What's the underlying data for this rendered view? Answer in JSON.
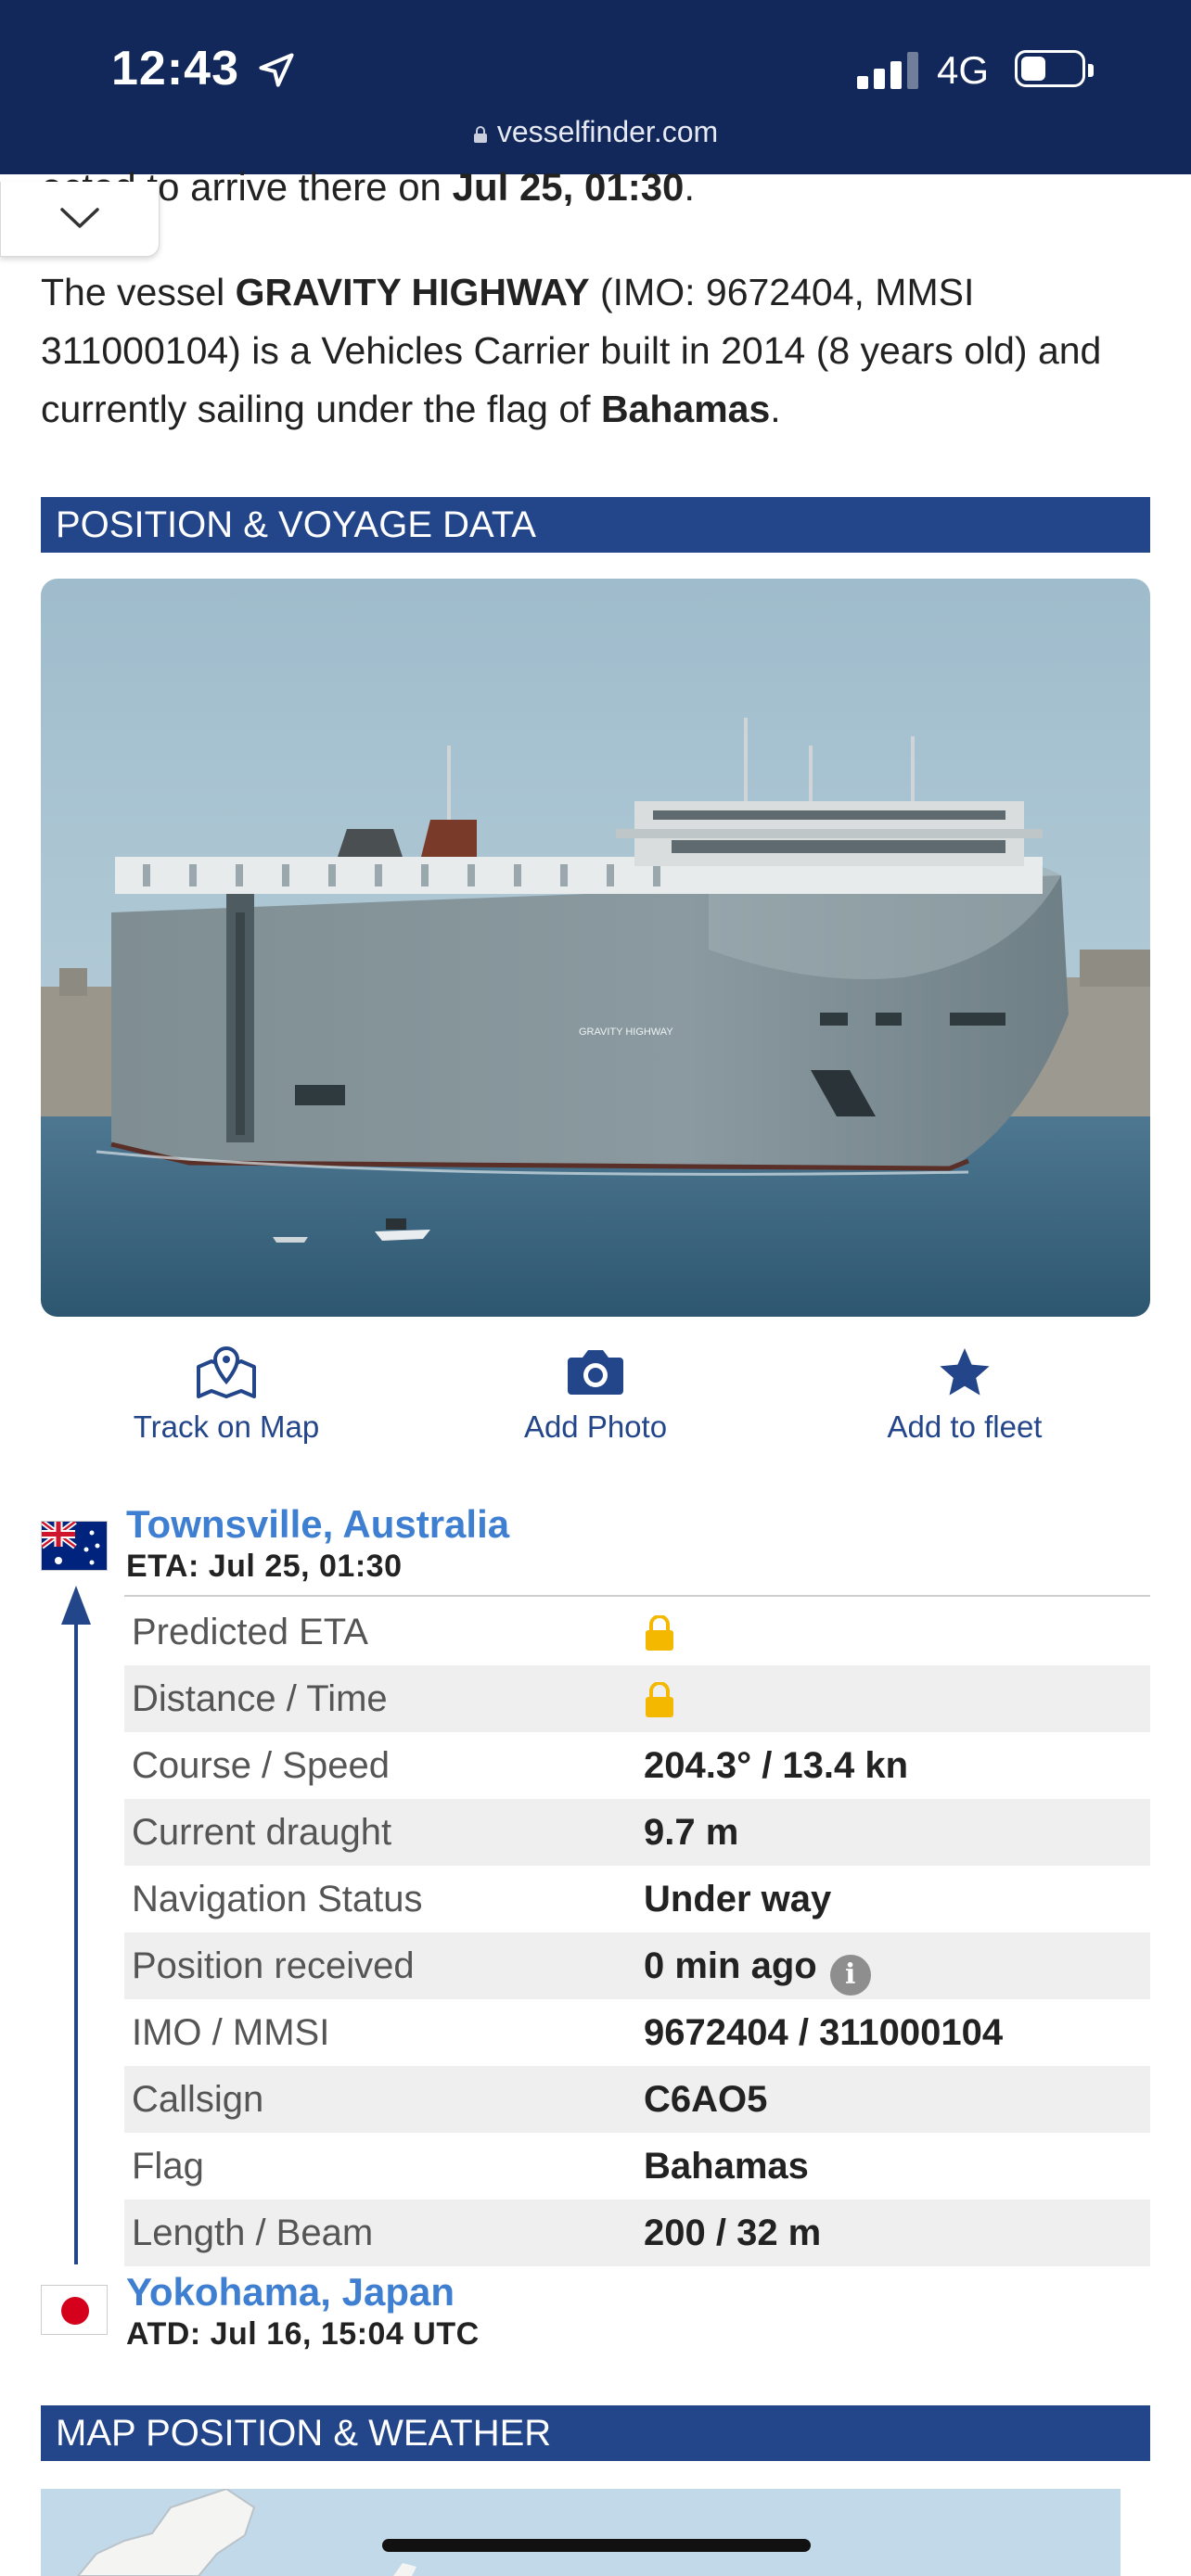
{
  "status": {
    "time": "12:43",
    "network": "4G",
    "battery_fraction": 0.4
  },
  "browser": {
    "url": "vesselfinder.com"
  },
  "intro": {
    "partial_prefix": "ected to arrive there on ",
    "partial_date": "Jul 25, 01:30",
    "partial_suffix": ".",
    "p1": "The vessel ",
    "vessel_name": "GRAVITY HIGHWAY",
    "p2": " (IMO: 9672404, MMSI 311000104) is a Vehicles Carrier built in 2014 (8 years old) and currently sailing under the flag of ",
    "flag_name": "Bahamas",
    "p3": "."
  },
  "sections": {
    "position_voyage": "POSITION & VOYAGE DATA",
    "map_weather": "MAP POSITION & WEATHER"
  },
  "photo": {
    "hull_text": "GRAVITY HIGHWAY"
  },
  "actions": {
    "track": "Track on Map",
    "photo": "Add Photo",
    "fleet": "Add to fleet"
  },
  "destination": {
    "port": "Townsville, Australia",
    "eta": "ETA: Jul 25, 01:30"
  },
  "departure": {
    "port": "Yokohama, Japan",
    "atd": "ATD: Jul 16, 15:04 UTC"
  },
  "details": [
    {
      "label": "Predicted ETA",
      "value": "",
      "locked": true
    },
    {
      "label": "Distance / Time",
      "value": "",
      "locked": true
    },
    {
      "label": "Course / Speed",
      "value": "204.3° / 13.4 kn"
    },
    {
      "label": "Current draught",
      "value": "9.7 m"
    },
    {
      "label": "Navigation Status",
      "value": "Under way"
    },
    {
      "label": "Position received",
      "value": "0 min ago",
      "info": true
    },
    {
      "label": "IMO / MMSI",
      "value": "9672404 / 311000104"
    },
    {
      "label": "Callsign",
      "value": "C6AO5"
    },
    {
      "label": "Flag",
      "value": "Bahamas"
    },
    {
      "label": "Length / Beam",
      "value": "200 / 32 m"
    }
  ],
  "colors": {
    "header_bg": "#12285a",
    "section_bg": "#23458a",
    "link": "#3f7fd1",
    "lock": "#f5b800"
  },
  "icons": {
    "location": "location-arrow-icon",
    "lock": "lock-icon",
    "chevron": "chevron-down-icon",
    "map": "map-pin-icon",
    "camera": "camera-icon",
    "star": "star-icon",
    "info": "info-icon"
  }
}
